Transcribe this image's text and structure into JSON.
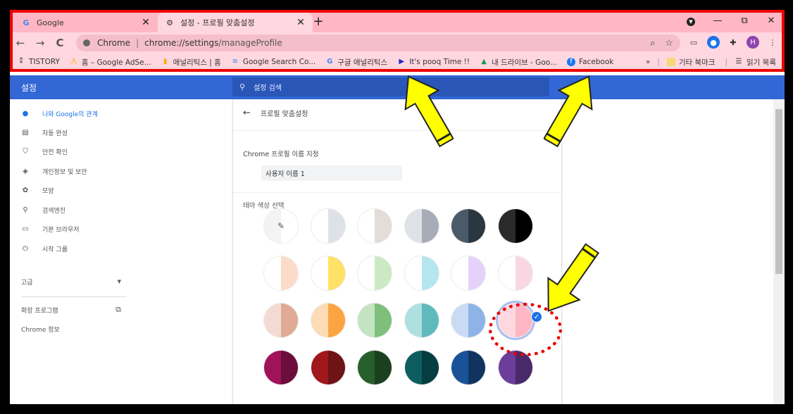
{
  "tabs": [
    {
      "label": "Google",
      "favicon": "google-g-icon"
    },
    {
      "label": "설정 - 프로필 맞춤설정",
      "favicon": "gear-icon"
    }
  ],
  "new_tab": "+",
  "window": {
    "minimize": "—",
    "maximize": "⧉",
    "close": "✕"
  },
  "toolbar": {
    "back": "←",
    "forward": "→",
    "reload": "C",
    "omnibox_scheme": "Chrome",
    "omnibox_sep": "|",
    "omnibox_host": "chrome://settings",
    "omnibox_path": "/manageProfile"
  },
  "extensions": {
    "avatar_letter": "H"
  },
  "bookmarks": [
    {
      "label": "TISTORY",
      "icon": "tistory-icon"
    },
    {
      "label": "홈 – Google AdSe...",
      "icon": "adsense-icon"
    },
    {
      "label": "애널리틱스 | 홈",
      "icon": "analytics-icon"
    },
    {
      "label": "Google Search Co...",
      "icon": "search-console-icon"
    },
    {
      "label": "구글 애널리틱스",
      "icon": "google-g-icon"
    },
    {
      "label": "It's pooq Time !!",
      "icon": "play-icon"
    },
    {
      "label": "내 드라이브 - Goo...",
      "icon": "drive-icon"
    },
    {
      "label": "Facebook",
      "icon": "facebook-icon"
    }
  ],
  "bookmarks_right": {
    "more": "»",
    "other": "기타 북마크",
    "reading": "읽기 목록"
  },
  "settings": {
    "title": "설정",
    "search_placeholder": "설정 검색"
  },
  "sidebar": {
    "items": [
      {
        "label": "나와 Google의 관계",
        "icon": "person-icon",
        "active": true
      },
      {
        "label": "자동 완성",
        "icon": "clipboard-icon"
      },
      {
        "label": "안전 확인",
        "icon": "shield-check-icon"
      },
      {
        "label": "개인정보 및 보안",
        "icon": "shield-icon"
      },
      {
        "label": "모양",
        "icon": "palette-icon"
      },
      {
        "label": "검색엔진",
        "icon": "search-icon"
      },
      {
        "label": "기본 브라우저",
        "icon": "browser-icon"
      },
      {
        "label": "시작 그룹",
        "icon": "power-icon"
      }
    ],
    "advanced": "고급",
    "extensions": "확장 프로그램",
    "about": "Chrome 정보"
  },
  "card": {
    "back_title": "프로필 맞춤설정",
    "name_label": "Chrome 프로필 이름 지정",
    "name_value": "사용자 이름 1",
    "theme_label": "테마 색상 선택"
  },
  "theme_colors": [
    [
      "#f1f3f4",
      "#ffffff"
    ],
    [
      "#ffffff",
      "#dee1e5"
    ],
    [
      "#ffffff",
      "#e3dcd8"
    ],
    [
      "#dee1e5",
      "#a8abb8"
    ],
    [
      "#4a5a68",
      "#2a3740"
    ],
    [
      "#2b2b2b",
      "#000000"
    ],
    [
      "#ffffff",
      "#fcdcc9"
    ],
    [
      "#ffffff",
      "#ffe165"
    ],
    [
      "#ffffff",
      "#cbeac4"
    ],
    [
      "#ffffff",
      "#b4e6f0"
    ],
    [
      "#ffffff",
      "#e5d2fb"
    ],
    [
      "#ffffff",
      "#f8d7e2"
    ],
    [
      "#f3dbd3",
      "#e0aa95"
    ],
    [
      "#fcdcb7",
      "#fca442"
    ],
    [
      "#c4e3c0",
      "#7ebf7b"
    ],
    [
      "#aee0e0",
      "#5fb9bd"
    ],
    [
      "#c9daf4",
      "#8db3e7"
    ],
    [
      "#ffd7e0",
      "#ffb7c5"
    ],
    [
      "#a0125a",
      "#6c0d3c"
    ],
    [
      "#a0171c",
      "#6e1316"
    ],
    [
      "#265f2c",
      "#1b4020"
    ],
    [
      "#0d5d60",
      "#063d40"
    ],
    [
      "#1a5299",
      "#11335f"
    ],
    [
      "#6c3d9a",
      "#4a2a6a"
    ]
  ],
  "selected_theme_index": 17,
  "accent": "#3367d6"
}
